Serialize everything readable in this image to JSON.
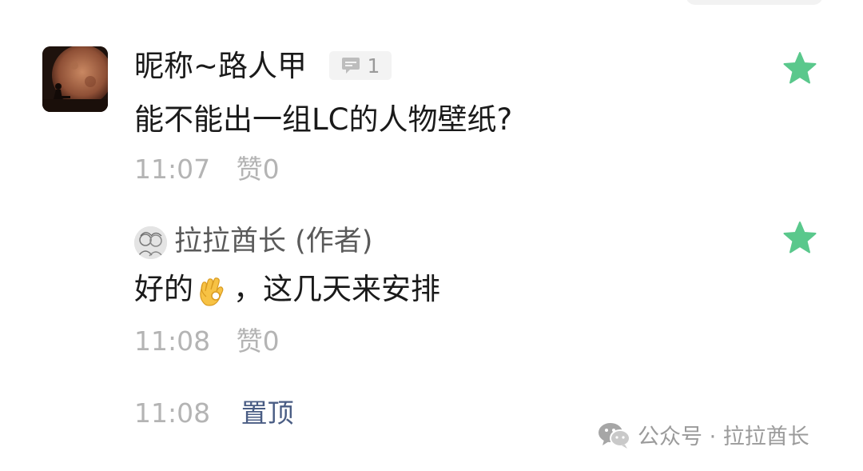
{
  "comment": {
    "user_name": "昵称~路人甲",
    "reply_count": "1",
    "text": "能不能出一组LC的人物壁纸?",
    "time": "11:07",
    "like_label": "赞0",
    "avatar_icon": "moon-silhouette-avatar",
    "star_icon": "star-icon",
    "star_color": "#5ac88c"
  },
  "reply": {
    "user_name": "拉拉酋长 (作者)",
    "text_before": "好的",
    "emoji": "ok-hand-emoji",
    "text_after": "，这几天来安排",
    "time": "11:08",
    "like_label": "赞0",
    "avatar_icon": "sketch-avatar",
    "star_icon": "star-icon",
    "star_color": "#5ac88c"
  },
  "pin": {
    "time": "11:08",
    "label": "置顶",
    "link_color": "#4a5d84"
  },
  "watermark": {
    "text": "公众号 · 拉拉酋长",
    "icon": "wechat-icon"
  }
}
